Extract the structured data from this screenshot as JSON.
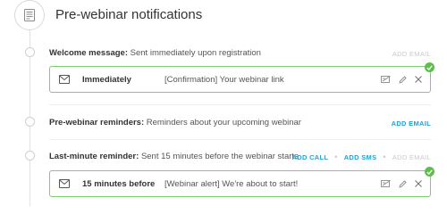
{
  "header": {
    "title": "Pre-webinar notifications",
    "icon": "document-icon"
  },
  "sections": {
    "welcome": {
      "title_bold": "Welcome message:",
      "title_rest": "Sent immediately upon registration",
      "add_email_label": "ADD EMAIL",
      "add_email_enabled": false,
      "card": {
        "timing": "Immediately",
        "subject": "[Confirmation] Your webinar link",
        "active": true
      }
    },
    "reminders": {
      "title_bold": "Pre-webinar reminders:",
      "title_rest": "Reminders about your upcoming webinar",
      "add_email_label": "ADD EMAIL",
      "add_email_enabled": true
    },
    "last_minute": {
      "title_bold": "Last-minute reminder:",
      "title_rest": "Sent 15 minutes before the webinar starts",
      "add_call_label": "ADD CALL",
      "add_sms_label": "ADD SMS",
      "add_email_label": "ADD EMAIL",
      "add_email_enabled": false,
      "separator": "•",
      "card": {
        "timing": "15 minutes before",
        "subject": "[Webinar alert] We're about to start!",
        "active": true
      }
    }
  },
  "colors": {
    "accent": "#1ea3d8",
    "success": "#5cbf4a",
    "card_border": "#7ccf6c",
    "disabled": "#c9c9c9"
  }
}
